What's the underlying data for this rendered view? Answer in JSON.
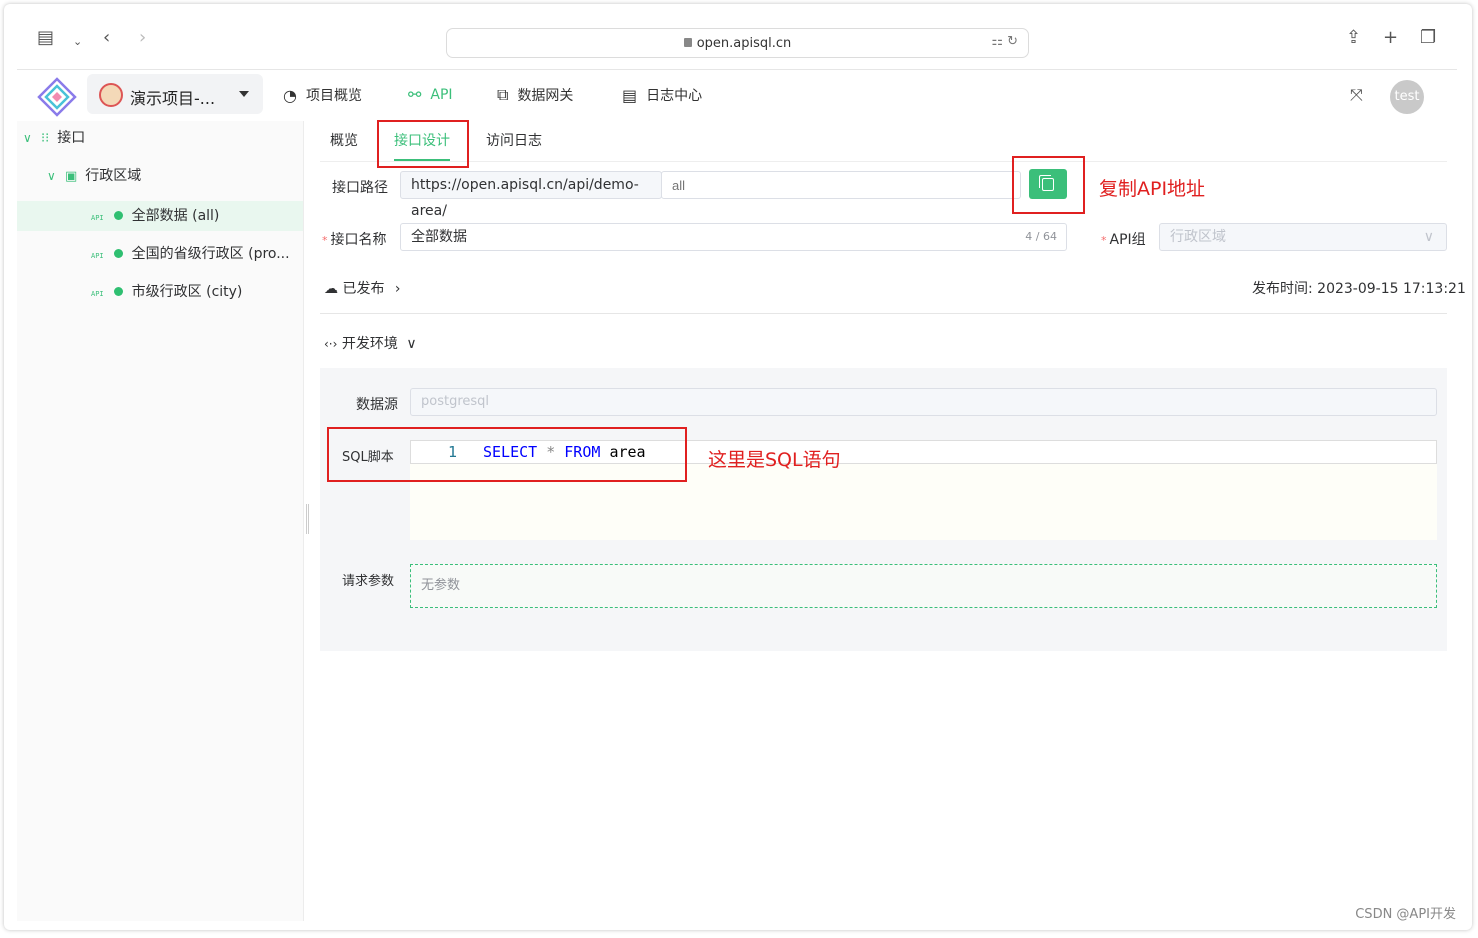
{
  "browser": {
    "url": "open.apisql.cn"
  },
  "header": {
    "project_name": "演示项目-...",
    "nav": [
      {
        "label": "项目概览",
        "icon": "dashboard-icon"
      },
      {
        "label": "API",
        "icon": "link-icon"
      },
      {
        "label": "数据网关",
        "icon": "gateway-icon"
      },
      {
        "label": "日志中心",
        "icon": "log-icon"
      }
    ],
    "user": "test"
  },
  "sidebar": {
    "root": "接口",
    "group": "行政区域",
    "api_tag": "API",
    "items": [
      {
        "label": "全部数据 (all)"
      },
      {
        "label": "全国的省级行政区 (pro..."
      },
      {
        "label": "市级行政区 (city)"
      }
    ]
  },
  "tabs": [
    "概览",
    "接口设计",
    "访问日志"
  ],
  "form": {
    "path_label": "接口路径",
    "path_prefix": "https://open.apisql.cn/api/demo-area/",
    "path_suffix_placeholder": "all",
    "name_label": "接口名称",
    "name_value": "全部数据",
    "name_count": "4 / 64",
    "group_label": "API组",
    "group_placeholder": "行政区域",
    "status": "已发布",
    "publish_time": "发布时间: 2023-09-15 17:13:21",
    "env": "开发环境",
    "datasource_label": "数据源",
    "datasource_value": "postgresql",
    "sql_label": "SQL脚本",
    "sql_line_no": "1",
    "sql_keyword1": "SELECT",
    "sql_op": "*",
    "sql_keyword2": "FROM",
    "sql_table": "area",
    "params_label": "请求参数",
    "params_empty": "无参数"
  },
  "annotations": {
    "copy": "复制API地址",
    "sql": "这里是SQL语句"
  },
  "colors": {
    "accent": "#3bbf7a",
    "annotation": "#e02020"
  },
  "watermark": "CSDN @API开发"
}
